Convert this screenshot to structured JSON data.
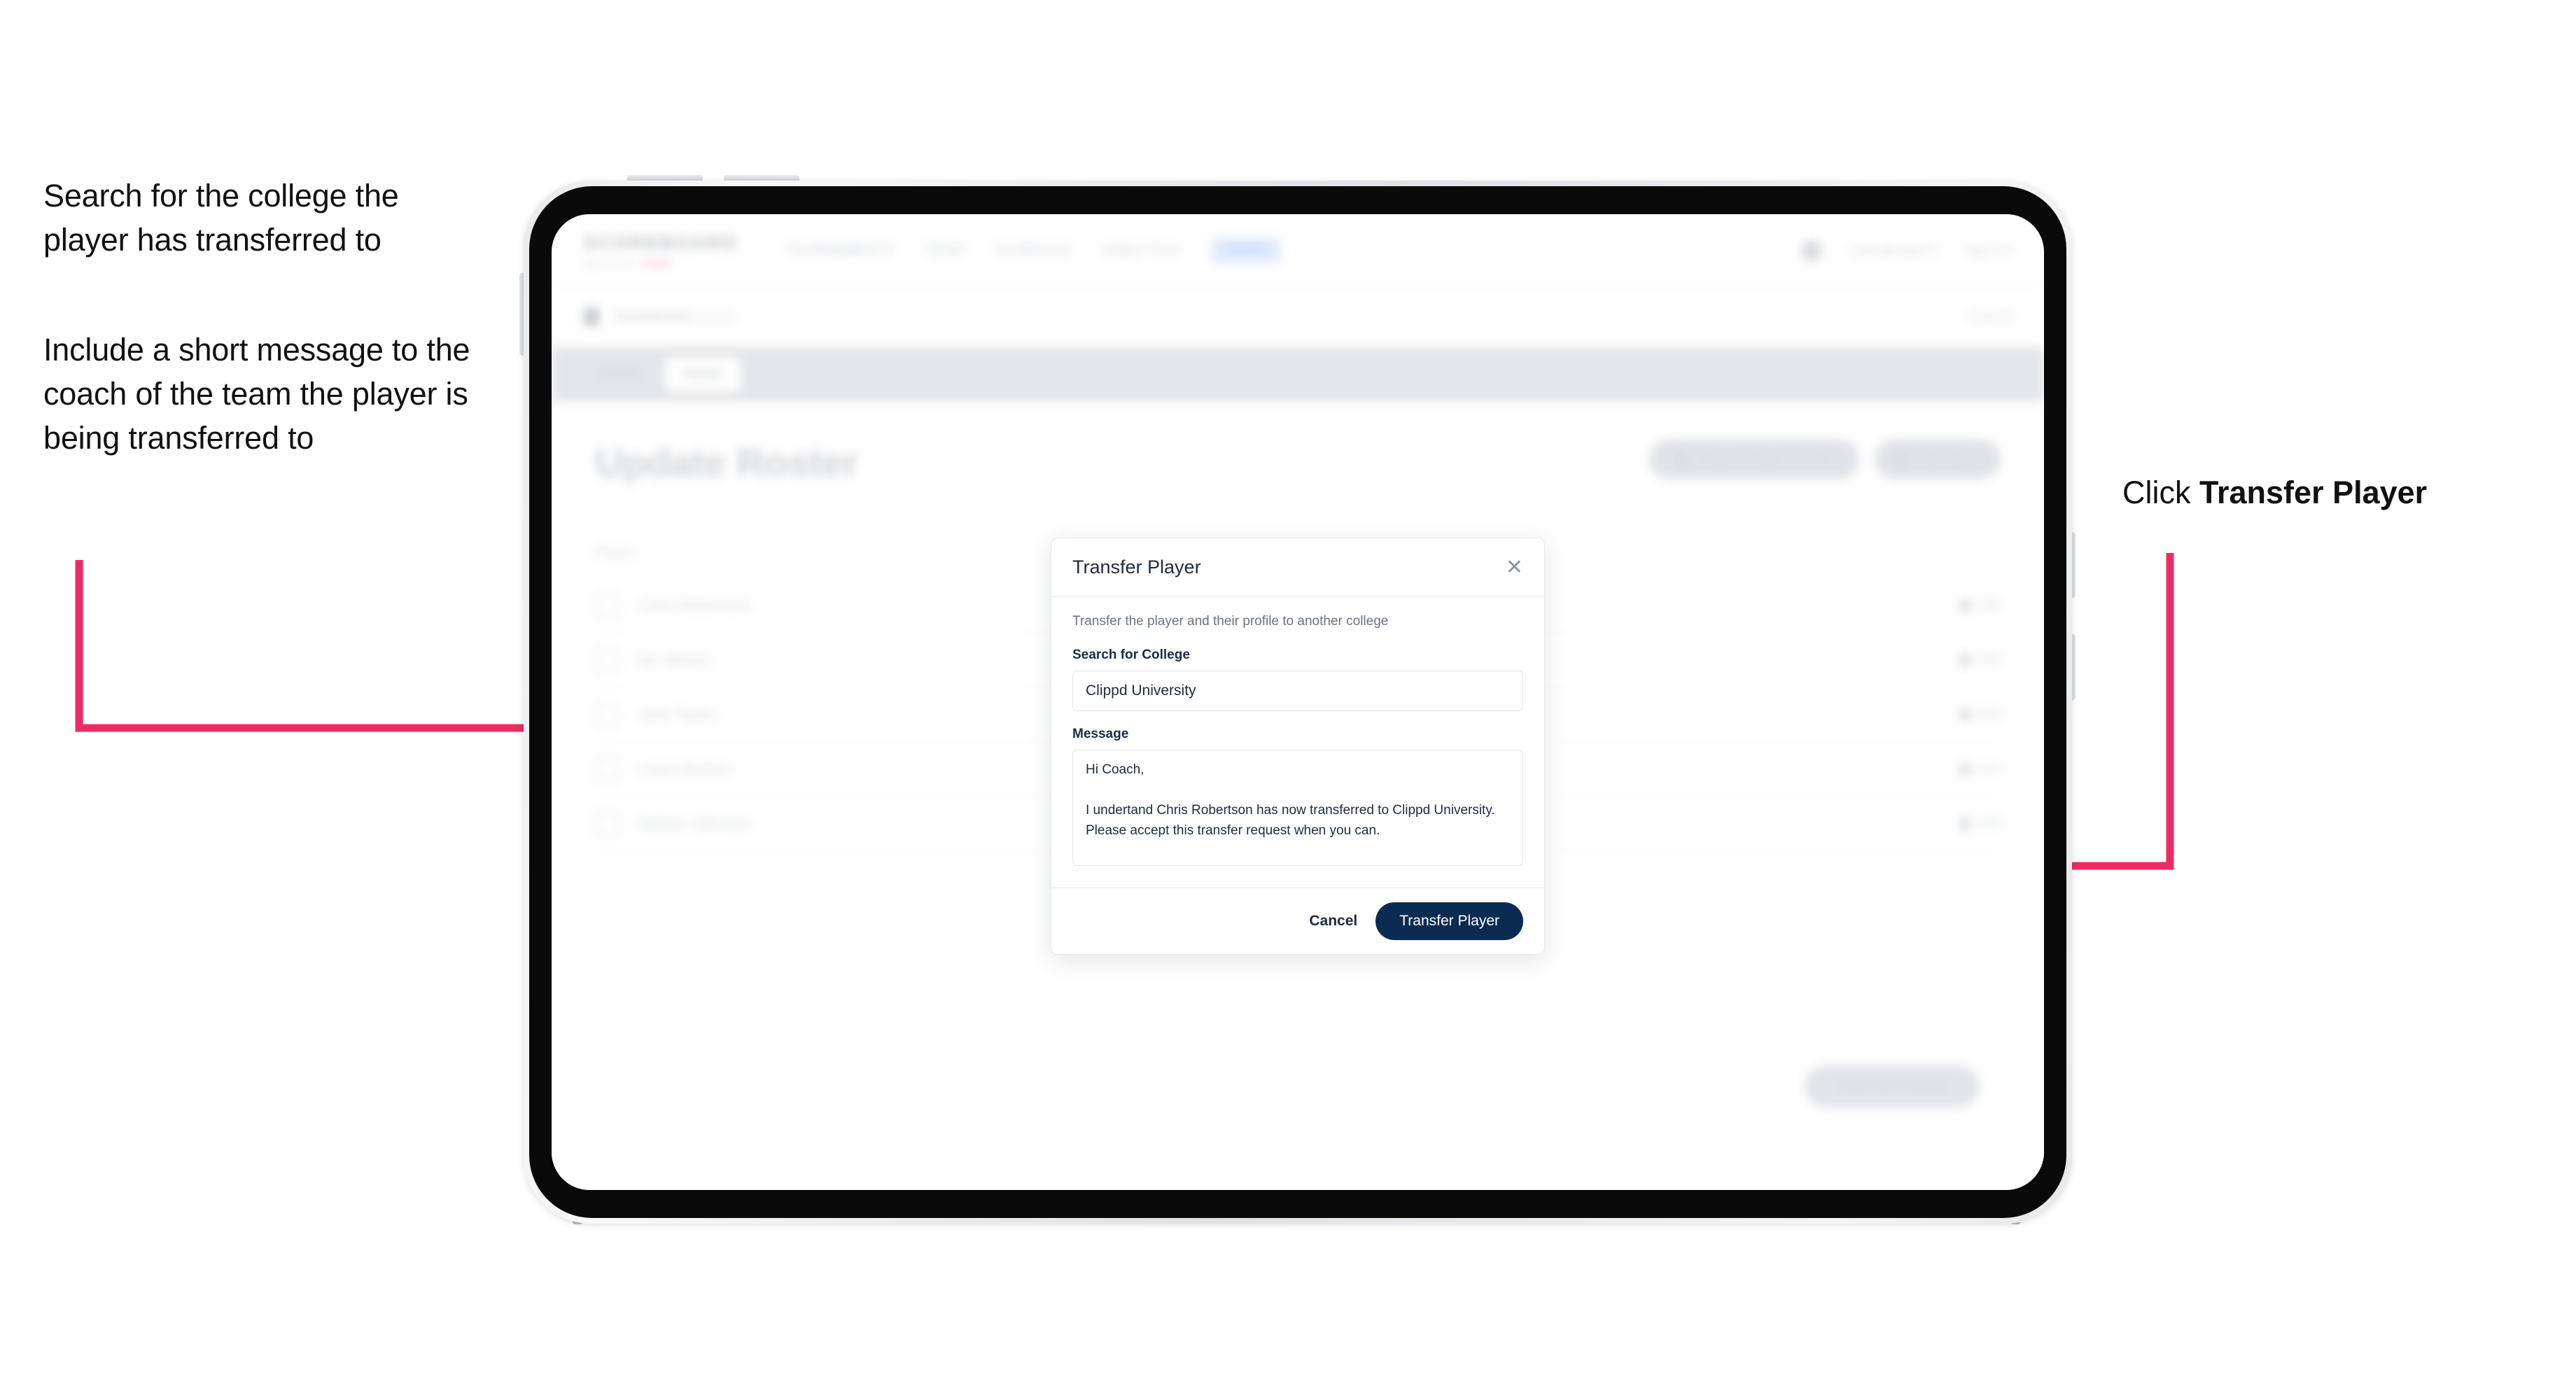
{
  "annotations": {
    "left_1": "Search for the college the player has transferred to",
    "left_2": "Include a short message to the coach of the team the player is being transferred to",
    "right_prefix": "Click ",
    "right_bold": "Transfer Player"
  },
  "colors": {
    "arrow": "#ee2a62",
    "primary_button": "#0b2b52",
    "modal_title": "#1d2b3f",
    "muted_text": "#6b7480"
  },
  "app": {
    "logo_main": "SCOREBOARD",
    "logo_sub_a": "powered by",
    "logo_sub_b": "clippd",
    "nav_items": [
      "TOURNAMENTS",
      "TEAM",
      "SCHEDULE",
      "ANALYTICS"
    ],
    "nav_pill": "ADMIN",
    "user_email": "coach@clippd.io",
    "sign_out": "Sign Out",
    "sub_title": "Scoreboard ",
    "sub_title_em": "Admin",
    "sub_right": "Cancel",
    "tabs": [
      {
        "label": "Details",
        "active": false
      },
      {
        "label": "Roster",
        "active": true
      }
    ],
    "page_title": "Update Roster",
    "actions": [
      {
        "label": "Request Player Transfer",
        "icon": "transfer-icon"
      },
      {
        "label": "Add Player",
        "icon": "plus-icon"
      }
    ],
    "list_header": "Player",
    "roster": [
      {
        "name": "Chris Robertson",
        "action": "Edit"
      },
      {
        "name": "Ian Wilson",
        "action": "Edit"
      },
      {
        "name": "John Taylor",
        "action": "Edit"
      },
      {
        "name": "Lewis Barnes",
        "action": "Edit"
      },
      {
        "name": "Nathan Johnson",
        "action": "Edit"
      }
    ],
    "footer_button": "Save And Continue"
  },
  "modal": {
    "title": "Transfer Player",
    "close_icon": "close-icon",
    "description": "Transfer the player and their profile to another college",
    "college_label": "Search for College",
    "college_value": "Clippd University",
    "college_placeholder": "Search for College",
    "message_label": "Message",
    "message_value": "Hi Coach,\n\nI undertand Chris Robertson has now transferred to Clippd University. Please accept this transfer request when you can.",
    "message_placeholder": "Message",
    "cancel_label": "Cancel",
    "submit_label": "Transfer Player"
  }
}
